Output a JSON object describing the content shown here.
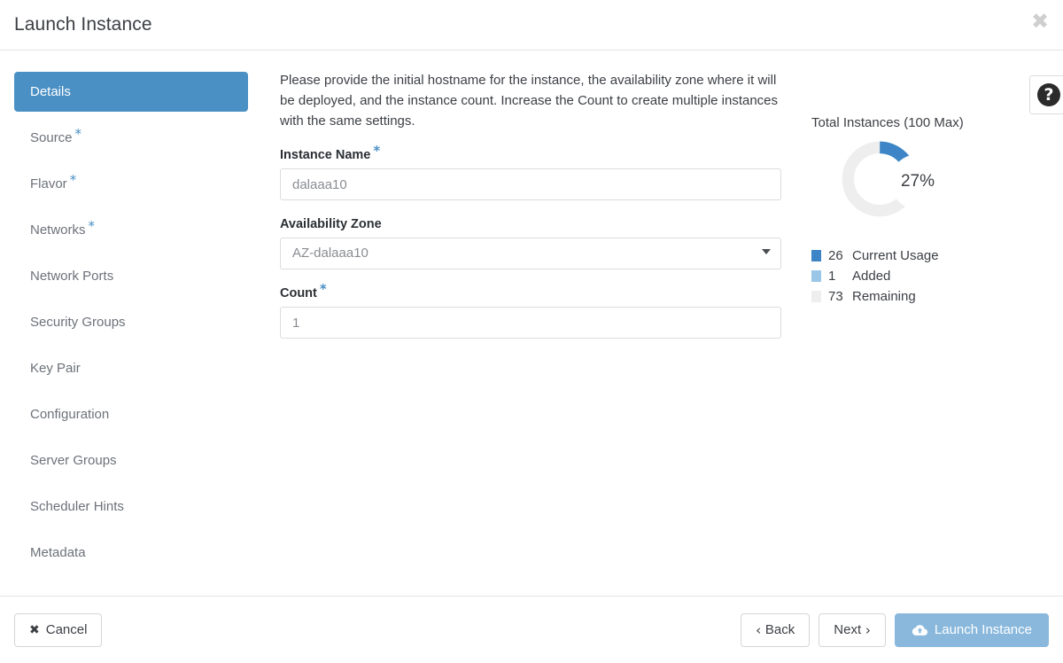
{
  "header": {
    "title": "Launch Instance",
    "close_icon": "close-icon"
  },
  "sidebar": {
    "items": [
      {
        "label": "Details",
        "required": false,
        "active": true
      },
      {
        "label": "Source",
        "required": true,
        "active": false
      },
      {
        "label": "Flavor",
        "required": true,
        "active": false
      },
      {
        "label": "Networks",
        "required": true,
        "active": false
      },
      {
        "label": "Network Ports",
        "required": false,
        "active": false
      },
      {
        "label": "Security Groups",
        "required": false,
        "active": false
      },
      {
        "label": "Key Pair",
        "required": false,
        "active": false
      },
      {
        "label": "Configuration",
        "required": false,
        "active": false
      },
      {
        "label": "Server Groups",
        "required": false,
        "active": false
      },
      {
        "label": "Scheduler Hints",
        "required": false,
        "active": false
      },
      {
        "label": "Metadata",
        "required": false,
        "active": false
      }
    ]
  },
  "main": {
    "intro": "Please provide the initial hostname for the instance, the availability zone where it will be deployed, and the instance count. Increase the Count to create multiple instances with the same settings.",
    "fields": {
      "instance_name": {
        "label": "Instance Name",
        "required": true,
        "value": "dalaaa10",
        "placeholder": ""
      },
      "availability_zone": {
        "label": "Availability Zone",
        "required": false,
        "value": "AZ-dalaaa10",
        "options": [
          "AZ-dalaaa10"
        ]
      },
      "count": {
        "label": "Count",
        "required": true,
        "value": "1",
        "placeholder": ""
      }
    },
    "help_icon": "question-mark-icon"
  },
  "quota": {
    "title": "Total Instances (100 Max)",
    "center_label": "27%",
    "legend": [
      {
        "value": "26",
        "label": "Current Usage",
        "color": "#3d85c6"
      },
      {
        "value": "1",
        "label": "Added",
        "color": "#9ac7e8"
      },
      {
        "value": "73",
        "label": "Remaining",
        "color": "#eeeeee"
      }
    ]
  },
  "chart_data": {
    "type": "pie",
    "title": "Total Instances (100 Max)",
    "categories": [
      "Current Usage",
      "Added",
      "Remaining"
    ],
    "values": [
      26,
      1,
      73
    ],
    "colors": [
      "#3d85c6",
      "#9ac7e8",
      "#eeeeee"
    ],
    "center_text": "27%",
    "total": 100,
    "unit": "instances",
    "legend": "bottom-left",
    "donut": true,
    "start_angle": 0
  },
  "footer": {
    "cancel": {
      "label": "Cancel",
      "icon": "x-icon"
    },
    "back": {
      "label": "Back",
      "icon": "chevron-left-icon"
    },
    "next": {
      "label": "Next",
      "icon": "chevron-right-icon"
    },
    "launch": {
      "label": "Launch Instance",
      "icon": "cloud-upload-icon"
    }
  }
}
